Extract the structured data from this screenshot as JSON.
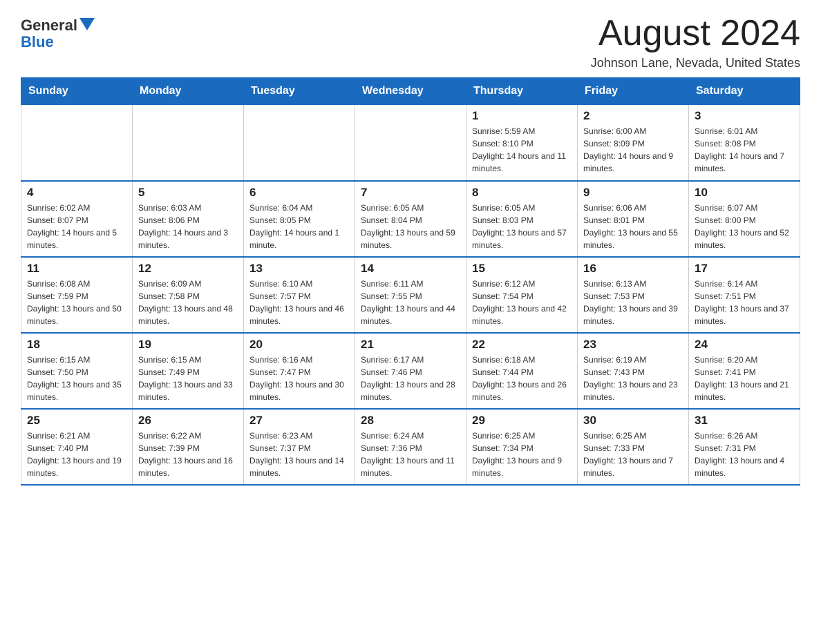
{
  "header": {
    "logo_general": "General",
    "logo_blue": "Blue",
    "month_title": "August 2024",
    "location": "Johnson Lane, Nevada, United States"
  },
  "weekdays": [
    "Sunday",
    "Monday",
    "Tuesday",
    "Wednesday",
    "Thursday",
    "Friday",
    "Saturday"
  ],
  "weeks": [
    [
      {
        "day": "",
        "info": ""
      },
      {
        "day": "",
        "info": ""
      },
      {
        "day": "",
        "info": ""
      },
      {
        "day": "",
        "info": ""
      },
      {
        "day": "1",
        "info": "Sunrise: 5:59 AM\nSunset: 8:10 PM\nDaylight: 14 hours and 11 minutes."
      },
      {
        "day": "2",
        "info": "Sunrise: 6:00 AM\nSunset: 8:09 PM\nDaylight: 14 hours and 9 minutes."
      },
      {
        "day": "3",
        "info": "Sunrise: 6:01 AM\nSunset: 8:08 PM\nDaylight: 14 hours and 7 minutes."
      }
    ],
    [
      {
        "day": "4",
        "info": "Sunrise: 6:02 AM\nSunset: 8:07 PM\nDaylight: 14 hours and 5 minutes."
      },
      {
        "day": "5",
        "info": "Sunrise: 6:03 AM\nSunset: 8:06 PM\nDaylight: 14 hours and 3 minutes."
      },
      {
        "day": "6",
        "info": "Sunrise: 6:04 AM\nSunset: 8:05 PM\nDaylight: 14 hours and 1 minute."
      },
      {
        "day": "7",
        "info": "Sunrise: 6:05 AM\nSunset: 8:04 PM\nDaylight: 13 hours and 59 minutes."
      },
      {
        "day": "8",
        "info": "Sunrise: 6:05 AM\nSunset: 8:03 PM\nDaylight: 13 hours and 57 minutes."
      },
      {
        "day": "9",
        "info": "Sunrise: 6:06 AM\nSunset: 8:01 PM\nDaylight: 13 hours and 55 minutes."
      },
      {
        "day": "10",
        "info": "Sunrise: 6:07 AM\nSunset: 8:00 PM\nDaylight: 13 hours and 52 minutes."
      }
    ],
    [
      {
        "day": "11",
        "info": "Sunrise: 6:08 AM\nSunset: 7:59 PM\nDaylight: 13 hours and 50 minutes."
      },
      {
        "day": "12",
        "info": "Sunrise: 6:09 AM\nSunset: 7:58 PM\nDaylight: 13 hours and 48 minutes."
      },
      {
        "day": "13",
        "info": "Sunrise: 6:10 AM\nSunset: 7:57 PM\nDaylight: 13 hours and 46 minutes."
      },
      {
        "day": "14",
        "info": "Sunrise: 6:11 AM\nSunset: 7:55 PM\nDaylight: 13 hours and 44 minutes."
      },
      {
        "day": "15",
        "info": "Sunrise: 6:12 AM\nSunset: 7:54 PM\nDaylight: 13 hours and 42 minutes."
      },
      {
        "day": "16",
        "info": "Sunrise: 6:13 AM\nSunset: 7:53 PM\nDaylight: 13 hours and 39 minutes."
      },
      {
        "day": "17",
        "info": "Sunrise: 6:14 AM\nSunset: 7:51 PM\nDaylight: 13 hours and 37 minutes."
      }
    ],
    [
      {
        "day": "18",
        "info": "Sunrise: 6:15 AM\nSunset: 7:50 PM\nDaylight: 13 hours and 35 minutes."
      },
      {
        "day": "19",
        "info": "Sunrise: 6:15 AM\nSunset: 7:49 PM\nDaylight: 13 hours and 33 minutes."
      },
      {
        "day": "20",
        "info": "Sunrise: 6:16 AM\nSunset: 7:47 PM\nDaylight: 13 hours and 30 minutes."
      },
      {
        "day": "21",
        "info": "Sunrise: 6:17 AM\nSunset: 7:46 PM\nDaylight: 13 hours and 28 minutes."
      },
      {
        "day": "22",
        "info": "Sunrise: 6:18 AM\nSunset: 7:44 PM\nDaylight: 13 hours and 26 minutes."
      },
      {
        "day": "23",
        "info": "Sunrise: 6:19 AM\nSunset: 7:43 PM\nDaylight: 13 hours and 23 minutes."
      },
      {
        "day": "24",
        "info": "Sunrise: 6:20 AM\nSunset: 7:41 PM\nDaylight: 13 hours and 21 minutes."
      }
    ],
    [
      {
        "day": "25",
        "info": "Sunrise: 6:21 AM\nSunset: 7:40 PM\nDaylight: 13 hours and 19 minutes."
      },
      {
        "day": "26",
        "info": "Sunrise: 6:22 AM\nSunset: 7:39 PM\nDaylight: 13 hours and 16 minutes."
      },
      {
        "day": "27",
        "info": "Sunrise: 6:23 AM\nSunset: 7:37 PM\nDaylight: 13 hours and 14 minutes."
      },
      {
        "day": "28",
        "info": "Sunrise: 6:24 AM\nSunset: 7:36 PM\nDaylight: 13 hours and 11 minutes."
      },
      {
        "day": "29",
        "info": "Sunrise: 6:25 AM\nSunset: 7:34 PM\nDaylight: 13 hours and 9 minutes."
      },
      {
        "day": "30",
        "info": "Sunrise: 6:25 AM\nSunset: 7:33 PM\nDaylight: 13 hours and 7 minutes."
      },
      {
        "day": "31",
        "info": "Sunrise: 6:26 AM\nSunset: 7:31 PM\nDaylight: 13 hours and 4 minutes."
      }
    ]
  ]
}
